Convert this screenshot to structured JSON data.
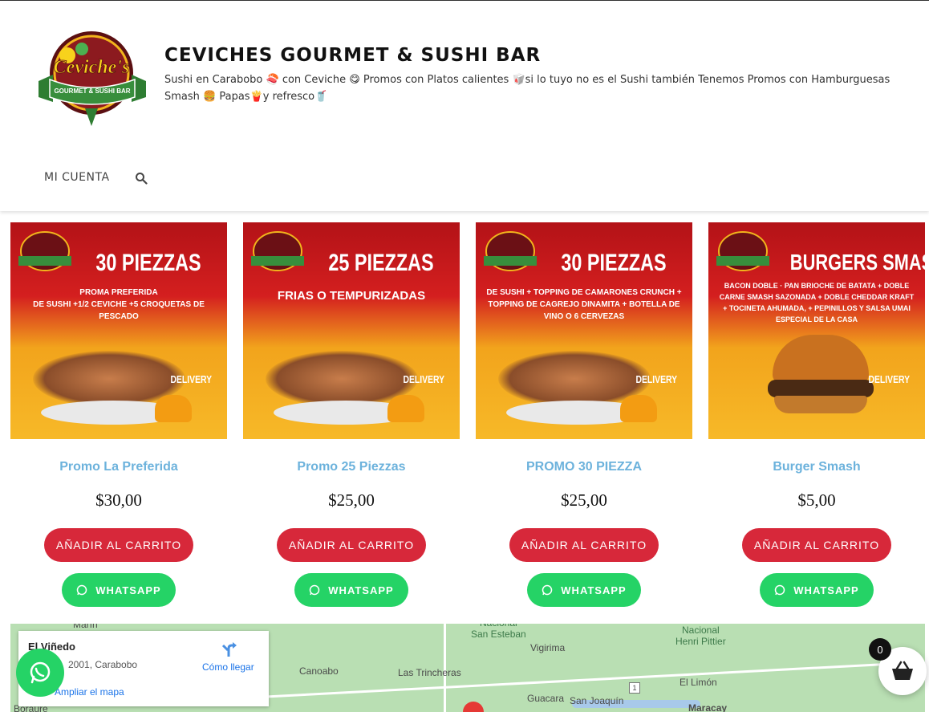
{
  "site": {
    "title": "CEVICHES GOURMET & SUSHI BAR",
    "description": "Sushi en Carabobo 🍣 con Ceviche 😋 Promos con Platos calientes 🥡si lo tuyo no es el Sushi también Tenemos Promos con Hamburguesas Smash 🍔 Papas🍟y refresco🥤",
    "logo_text_main": "Ceviche's",
    "logo_text_ribbon": "GOURMET & SUSHI BAR"
  },
  "nav": {
    "account_label": "MI CUENTA",
    "search_icon": "search-icon"
  },
  "products": [
    {
      "headline": "30 PIEZZAS",
      "subline": "PROMA PREFERIDA\nDE SUSHI +1/2 CEVICHE +5 CROQUETAS DE PESCADO",
      "badge": "DELIVERY",
      "name": "Promo La Preferida",
      "price": "$30,00",
      "cart_label": "AÑADIR AL CARRITO",
      "whatsapp_label": "WHATSAPP"
    },
    {
      "headline": "25 PIEZZAS",
      "subline": "FRIAS O TEMPURIZADAS",
      "badge": "DELIVERY",
      "name": "Promo 25 Piezzas",
      "price": "$25,00",
      "cart_label": "AÑADIR AL CARRITO",
      "whatsapp_label": "WHATSAPP"
    },
    {
      "headline": "30 PIEZZAS",
      "subline": "DE SUSHI + TOPPING DE CAMARONES CRUNCH + TOPPING DE CAGREJO DINAMITA + BOTELLA DE VINO O 6 CERVEZAS",
      "badge": "DELIVERY",
      "name": "PROMO 30 PIEZZA",
      "price": "$25,00",
      "cart_label": "AÑADIR AL CARRITO",
      "whatsapp_label": "WHATSAPP"
    },
    {
      "headline": "BURGERS SMASH",
      "subline": "BACON DOBLE · PAN BRIOCHE DE BATATA + DOBLE CARNE SMASH SAZONADA + DOBLE CHEDDAR KRAFT + TOCINETA AHUMADA, + PEPINILLOS Y SALSA UMAI ESPECIAL DE LA CASA",
      "badge": "DELIVERY",
      "name": "Burger Smash",
      "price": "$5,00",
      "cart_label": "AÑADIR AL CARRITO",
      "whatsapp_label": "WHATSAPP"
    }
  ],
  "map": {
    "place_name": "El Viñedo",
    "address": "2001, Carabobo",
    "directions_label": "Cómo llegar",
    "enlarge_label": "Ampliar el mapa",
    "labels": {
      "marin": "Marín",
      "san_esteban": "Nacional\nSan Esteban",
      "vigirima": "Vigirima",
      "henri_pittier": "Nacional\nHenri Pittier",
      "canoabo": "Canoabo",
      "las_trincheras": "Las Trincheras",
      "el_limon": "El Limón",
      "guacara": "Guacara",
      "san_joaquin": "San Joaquín",
      "maracay": "Maracay",
      "boraure": "Boraure",
      "route": "1"
    }
  },
  "cart": {
    "count": "0"
  },
  "colors": {
    "accent_red": "#d7283a",
    "whatsapp_green": "#25d366",
    "product_name_blue": "#6cb2dc"
  }
}
